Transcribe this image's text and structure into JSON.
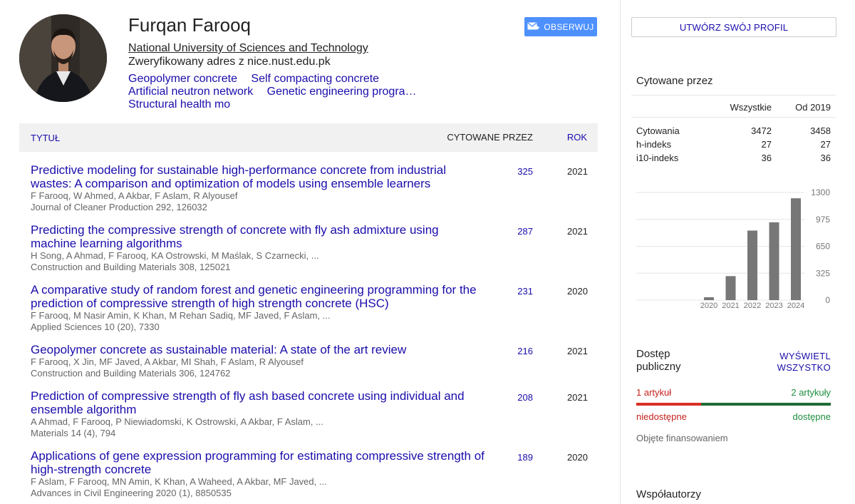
{
  "profile": {
    "name": "Furqan Farooq",
    "affiliation": "National University of Sciences and Technology",
    "email_line": "Zweryfikowany adres z nice.nust.edu.pk",
    "interests": [
      "Geopolymer concrete",
      "Self compacting concrete",
      "Artificial neutron network",
      "Genetic engineering progra…",
      "Structural health mo"
    ],
    "follow_label": "OBSERWUJ",
    "follow_icon": "mail-icon"
  },
  "table": {
    "col_title": "TYTUŁ",
    "col_cited": "CYTOWANE PRZEZ",
    "col_year": "ROK"
  },
  "articles": [
    {
      "title": "Predictive modeling for sustainable high-performance concrete from industrial wastes: A comparison and optimization of models using ensemble learners",
      "authors": "F Farooq, W Ahmed, A Akbar, F Aslam, R Alyousef",
      "venue": "Journal of Cleaner Production 292, 126032",
      "cites": "325",
      "year": "2021"
    },
    {
      "title": "Predicting the compressive strength of concrete with fly ash admixture using machine learning algorithms",
      "authors": "H Song, A Ahmad, F Farooq, KA Ostrowski, M Maślak, S Czarnecki, ...",
      "venue": "Construction and Building Materials 308, 125021",
      "cites": "287",
      "year": "2021"
    },
    {
      "title": "A comparative study of random forest and genetic engineering programming for the prediction of compressive strength of high strength concrete (HSC)",
      "authors": "F Farooq, M Nasir Amin, K Khan, M Rehan Sadiq, MF Javed, F Aslam, ...",
      "venue": "Applied Sciences 10 (20), 7330",
      "cites": "231",
      "year": "2020"
    },
    {
      "title": "Geopolymer concrete as sustainable material: A state of the art review",
      "authors": "F Farooq, X Jin, MF Javed, A Akbar, MI Shah, F Aslam, R Alyousef",
      "venue": "Construction and Building Materials 306, 124762",
      "cites": "216",
      "year": "2021"
    },
    {
      "title": "Prediction of compressive strength of fly ash based concrete using individual and ensemble algorithm",
      "authors": "A Ahmad, F Farooq, P Niewiadomski, K Ostrowski, A Akbar, F Aslam, ...",
      "venue": "Materials 14 (4), 794",
      "cites": "208",
      "year": "2021"
    },
    {
      "title": "Applications of gene expression programming for estimating compressive strength of high-strength concrete",
      "authors": "F Aslam, F Farooq, MN Amin, K Khan, A Waheed, A Akbar, MF Javed, ...",
      "venue": "Advances in Civil Engineering 2020 (1), 8850535",
      "cites": "189",
      "year": "2020"
    }
  ],
  "sidebar": {
    "create_profile": "UTWÓRZ SWÓJ PROFIL",
    "cited_by_title": "Cytowane przez",
    "col_all": "Wszystkie",
    "col_since": "Od 2019",
    "rows": [
      {
        "label": "Cytowania",
        "all": "3472",
        "since": "3458"
      },
      {
        "label": "h-indeks",
        "all": "27",
        "since": "27"
      },
      {
        "label": "i10-indeks",
        "all": "36",
        "since": "36"
      }
    ]
  },
  "chart_data": {
    "type": "bar",
    "categories": [
      "2020",
      "2021",
      "2022",
      "2023",
      "2024"
    ],
    "values": [
      35,
      290,
      840,
      940,
      1230
    ],
    "yticks": [
      "1300",
      "975",
      "650",
      "325",
      "0"
    ],
    "ylim": [
      0,
      1300
    ],
    "grid": true,
    "bar_color": "#777777"
  },
  "access": {
    "title": "Dostęp publiczny",
    "view_all": "WYŚWIETL WSZYSTKO",
    "unavailable_count": "1 artykuł",
    "available_count": "2 artykuły",
    "unavailable_label": "niedostępne",
    "available_label": "dostępne",
    "funded_label": "Objęte finansowaniem",
    "unavailable_fraction": 0.333
  },
  "coauthors_title": "Współautorzy"
}
